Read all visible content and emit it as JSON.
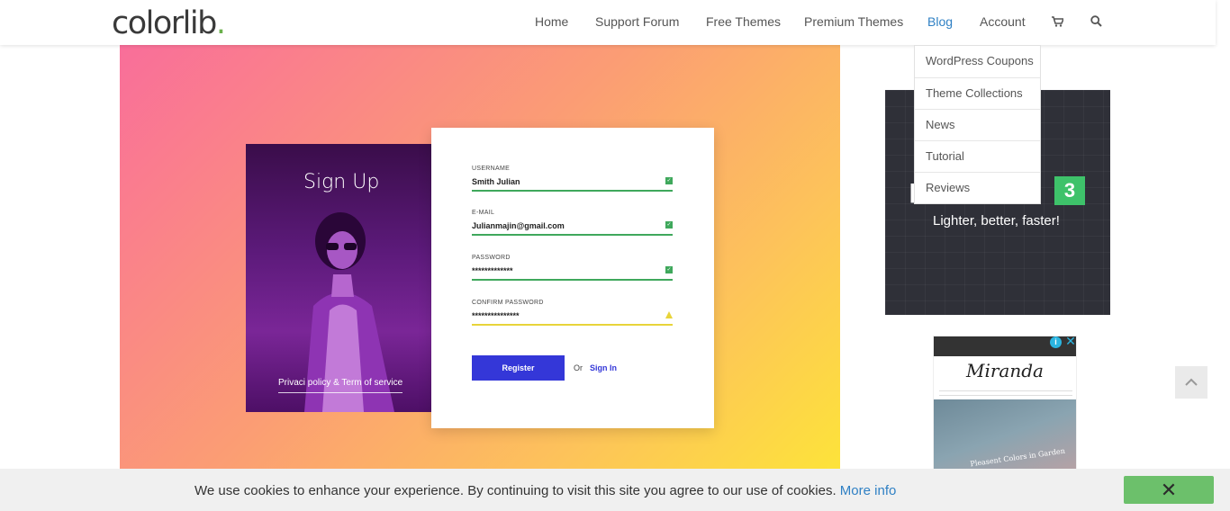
{
  "header": {
    "logo_text": "colorlib",
    "logo_dot": ".",
    "nav": [
      "Home",
      "Support Forum",
      "Free Themes",
      "Premium Themes",
      "Blog",
      "Account"
    ],
    "active_item": "Blog",
    "icons": [
      "cart-icon",
      "search-icon"
    ]
  },
  "dropdown": {
    "items": [
      "WordPress Coupons",
      "Theme Collections",
      "News",
      "Tutorial",
      "Reviews"
    ]
  },
  "hero": {
    "photo_title": "Sign Up",
    "photo_link": "Privaci policy & Term of service",
    "form": {
      "fields": [
        {
          "label": "USERNAME",
          "value": "Smith Julian",
          "status": "valid"
        },
        {
          "label": "E-MAIL",
          "value": "Julianmajin@gmail.com",
          "status": "valid"
        },
        {
          "label": "PASSWORD",
          "value": "*************",
          "status": "valid"
        },
        {
          "label": "CONFIRM PASSWORD",
          "value": "***************",
          "status": "warning"
        }
      ],
      "register_label": "Register",
      "or_label": "Or",
      "signin_label": "Sign In"
    }
  },
  "ads": {
    "ad1": {
      "badge": "3",
      "tagline": "Lighter, better, faster!"
    },
    "ad2": {
      "title": "Miranda",
      "image_text": "Pleasent Colors in Garden"
    }
  },
  "cookie": {
    "message": "We use cookies to enhance your experience. By continuing to visit this site you agree to our use of cookies.",
    "link": "More info",
    "close_symbol": "✕"
  },
  "colors": {
    "accent": "#2f80c4",
    "register_button": "#3437d8",
    "valid": "#3fa85c",
    "warning": "#e8d43a",
    "cookie_close": "#6cc06b"
  }
}
